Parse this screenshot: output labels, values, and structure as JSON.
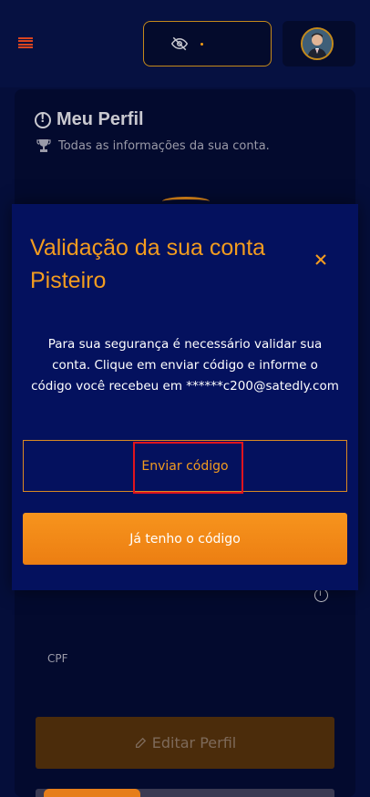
{
  "header": {
    "menu_icon": "hamburger-icon",
    "balance_icon": "eye-slash-icon",
    "balance_value": "•",
    "avatar_icon": "user-avatar"
  },
  "profile": {
    "title": "Meu Perfil",
    "subtitle": "Todas as informações da sua conta.",
    "title_icon": "info-circle-icon",
    "subtitle_icon": "trophy-icon",
    "cpf_label": "CPF",
    "edit_button": "Editar Perfil"
  },
  "modal": {
    "title": "Validação da sua conta Pisteiro",
    "message": "Para sua segurança é necessário validar sua conta. Clique em enviar código e informe o código você recebeu em ******c200@satedly.com",
    "send_code_label": "Enviar código",
    "have_code_label": "Já tenho o código",
    "close_icon": "close-icon"
  },
  "colors": {
    "accent": "#f39c1f",
    "background": "#050e3a",
    "modal_bg": "#04115e",
    "highlight": "#e0141e"
  }
}
